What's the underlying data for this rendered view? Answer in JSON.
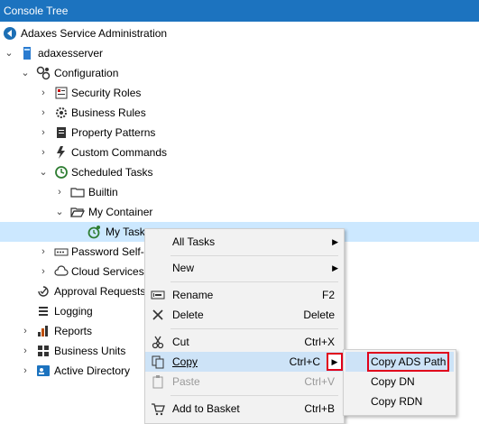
{
  "header": {
    "title": "Console Tree"
  },
  "tree": {
    "root": "Adaxes Service Administration",
    "server": "adaxesserver",
    "configuration": "Configuration",
    "security_roles": "Security Roles",
    "business_rules": "Business Rules",
    "property_patterns": "Property Patterns",
    "custom_commands": "Custom Commands",
    "scheduled_tasks": "Scheduled Tasks",
    "builtin": "Builtin",
    "my_container": "My Container",
    "my_task": "My Task",
    "password_self_service": "Password Self-Se",
    "cloud_services": "Cloud Services",
    "approval_requests": "Approval Requests",
    "logging": "Logging",
    "reports": "Reports",
    "business_units": "Business Units",
    "active_directory": "Active Directory"
  },
  "context_menu": {
    "all_tasks": "All Tasks",
    "new": "New",
    "rename": "Rename",
    "rename_key": "F2",
    "delete": "Delete",
    "delete_key": "Delete",
    "cut": "Cut",
    "cut_key": "Ctrl+X",
    "copy": "Copy",
    "copy_key": "Ctrl+C",
    "paste": "Paste",
    "paste_key": "Ctrl+V",
    "add_to_basket": "Add to Basket",
    "add_to_basket_key": "Ctrl+B"
  },
  "copy_submenu": {
    "copy_ads_path": "Copy ADS Path",
    "copy_dn": "Copy DN",
    "copy_rdn": "Copy RDN"
  },
  "colors": {
    "header": "#1c73bf",
    "selection": "#cce8ff",
    "highlight_box": "#e0001b"
  }
}
